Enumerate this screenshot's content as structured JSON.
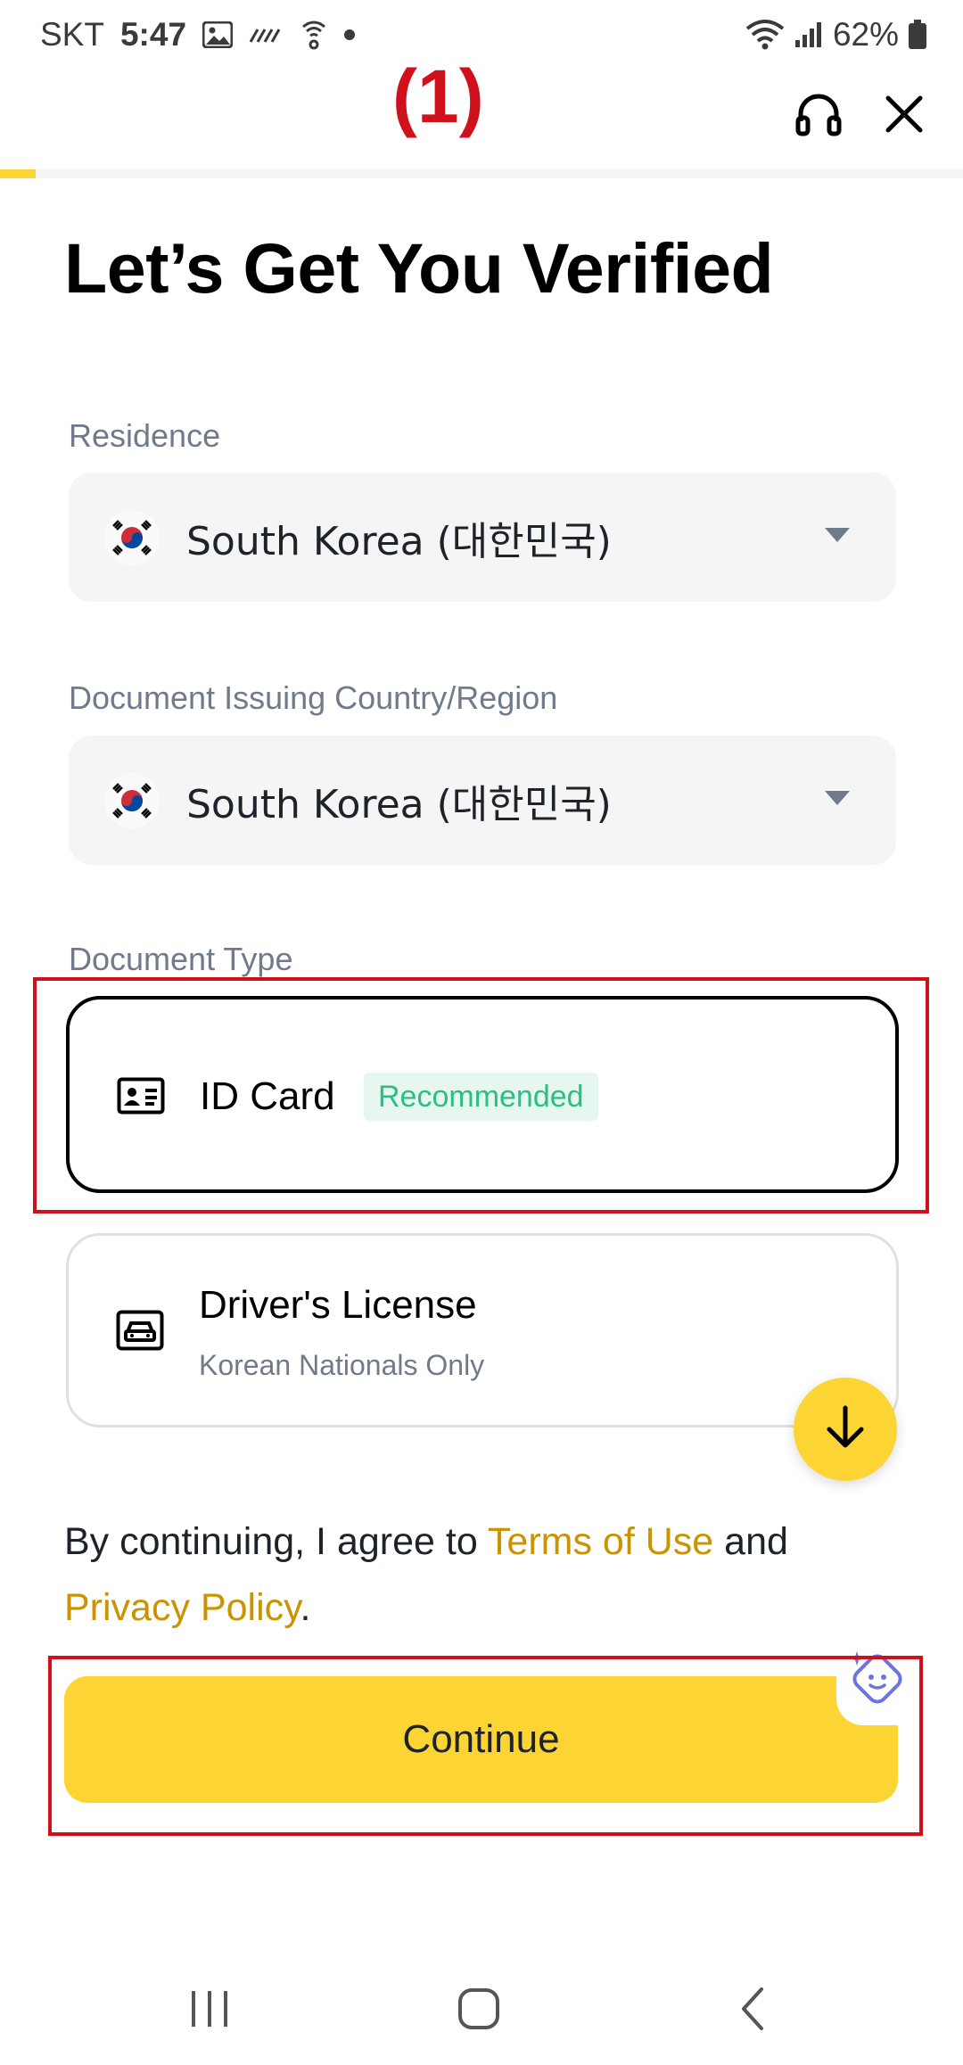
{
  "status_bar": {
    "carrier": "SKT",
    "time": "5:47",
    "battery": "62%"
  },
  "header": {
    "annotation_label": "(1)",
    "progress_fraction": 0.037
  },
  "page": {
    "title": "Let’s Get You Verified"
  },
  "residence": {
    "label": "Residence",
    "value": "South Korea (대한민국)"
  },
  "issuing_country": {
    "label": "Document Issuing Country/Region",
    "value": "South Korea (대한민국)"
  },
  "document_type": {
    "label": "Document Type",
    "options": [
      {
        "title": "ID Card",
        "badge": "Recommended",
        "selected": true
      },
      {
        "title": "Driver's License",
        "subtitle": "Korean Nationals Only",
        "selected": false
      }
    ]
  },
  "terms": {
    "prefix": "By continuing, I agree to ",
    "terms_link": "Terms of Use",
    "middle": " and",
    "privacy_link": "Privacy Policy",
    "suffix": "."
  },
  "continue_button": {
    "label": "Continue"
  },
  "colors": {
    "brand_yellow": "#fcd535",
    "link_gold": "#c99400",
    "badge_green": "#2ebd85",
    "highlight_red": "#d0111b"
  },
  "icons": {
    "support": "headset-icon",
    "close": "close-icon",
    "id_card": "id-card-icon",
    "driver_license": "car-icon",
    "scroll_down": "arrow-down-icon",
    "assistant": "ai-assistant-icon"
  }
}
